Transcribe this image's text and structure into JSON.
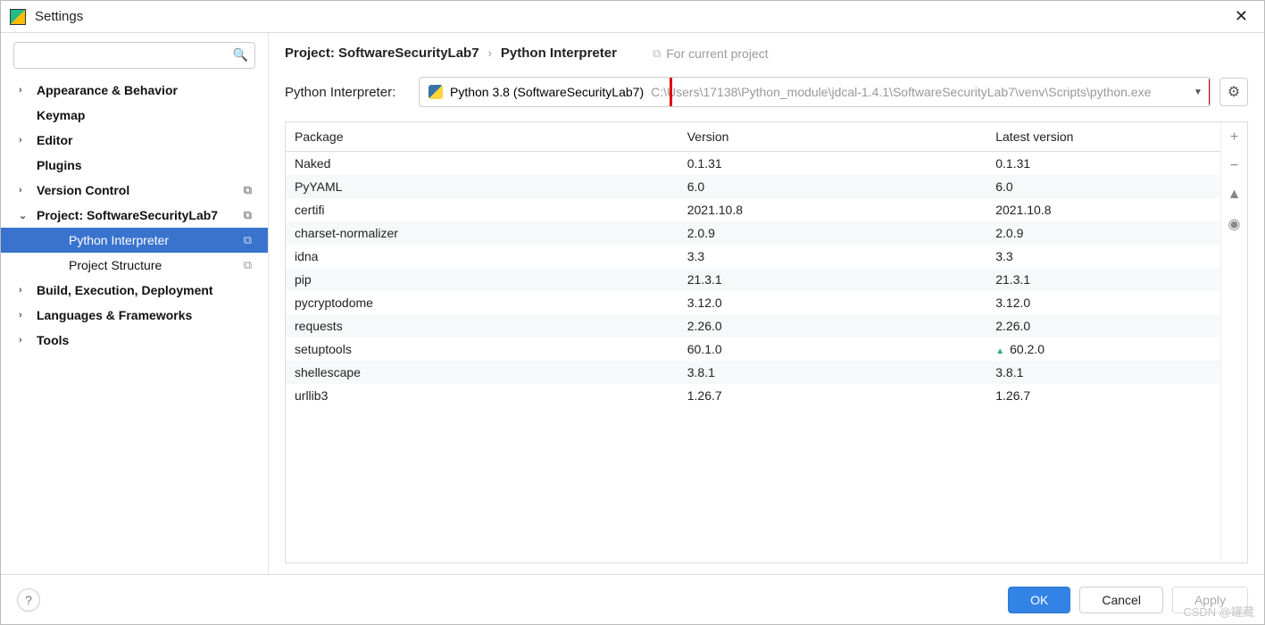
{
  "window": {
    "title": "Settings"
  },
  "search": {
    "placeholder": ""
  },
  "sidebar": {
    "items": [
      {
        "label": "Appearance & Behavior",
        "expandable": true,
        "expanded": false
      },
      {
        "label": "Keymap",
        "expandable": false
      },
      {
        "label": "Editor",
        "expandable": true,
        "expanded": false
      },
      {
        "label": "Plugins",
        "expandable": false
      },
      {
        "label": "Version Control",
        "expandable": true,
        "expanded": false,
        "has_copy": true
      },
      {
        "label": "Project: SoftwareSecurityLab7",
        "expandable": true,
        "expanded": true,
        "has_copy": true
      },
      {
        "label": "Python Interpreter",
        "level": 2,
        "selected": true,
        "has_copy": true
      },
      {
        "label": "Project Structure",
        "level": 2,
        "has_copy": true
      },
      {
        "label": "Build, Execution, Deployment",
        "expandable": true,
        "expanded": false
      },
      {
        "label": "Languages & Frameworks",
        "expandable": true,
        "expanded": false
      },
      {
        "label": "Tools",
        "expandable": true,
        "expanded": false
      }
    ]
  },
  "breadcrumb": {
    "part1": "Project: SoftwareSecurityLab7",
    "part2": "Python Interpreter",
    "project_hint": "For current project"
  },
  "interpreter": {
    "label": "Python Interpreter:",
    "name": "Python 3.8 (SoftwareSecurityLab7)",
    "path": "C:\\Users\\17138\\Python_module\\jdcal-1.4.1\\SoftwareSecurityLab7\\venv\\Scripts\\python.exe"
  },
  "table": {
    "headers": {
      "package": "Package",
      "version": "Version",
      "latest": "Latest version"
    },
    "rows": [
      {
        "package": "Naked",
        "version": "0.1.31",
        "latest": "0.1.31"
      },
      {
        "package": "PyYAML",
        "version": "6.0",
        "latest": "6.0"
      },
      {
        "package": "certifi",
        "version": "2021.10.8",
        "latest": "2021.10.8"
      },
      {
        "package": "charset-normalizer",
        "version": "2.0.9",
        "latest": "2.0.9"
      },
      {
        "package": "idna",
        "version": "3.3",
        "latest": "3.3"
      },
      {
        "package": "pip",
        "version": "21.3.1",
        "latest": "21.3.1"
      },
      {
        "package": "pycryptodome",
        "version": "3.12.0",
        "latest": "3.12.0"
      },
      {
        "package": "requests",
        "version": "2.26.0",
        "latest": "2.26.0"
      },
      {
        "package": "setuptools",
        "version": "60.1.0",
        "latest": "60.2.0",
        "update": true
      },
      {
        "package": "shellescape",
        "version": "3.8.1",
        "latest": "3.8.1"
      },
      {
        "package": "urllib3",
        "version": "1.26.7",
        "latest": "1.26.7"
      }
    ]
  },
  "footer": {
    "ok": "OK",
    "cancel": "Cancel",
    "apply": "Apply"
  },
  "watermark": "CSDN @罐藏"
}
